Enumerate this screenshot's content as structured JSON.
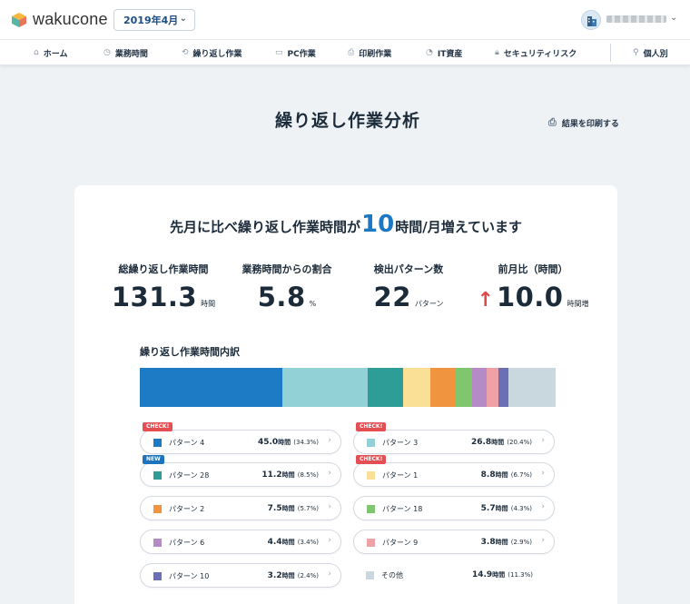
{
  "header": {
    "logo_text": "wakucone",
    "month": "2019年4月",
    "user_name_redacted": ""
  },
  "nav": {
    "items": [
      {
        "label": "ホーム",
        "icon": "home-icon"
      },
      {
        "label": "業務時間",
        "icon": "clock-icon"
      },
      {
        "label": "繰り返し作業",
        "icon": "repeat-icon"
      },
      {
        "label": "PC作業",
        "icon": "monitor-icon"
      },
      {
        "label": "印刷作業",
        "icon": "printer-icon"
      },
      {
        "label": "IT資産",
        "icon": "asset-icon"
      },
      {
        "label": "セキュリティリスク",
        "icon": "lock-icon"
      },
      {
        "label": "個人別",
        "icon": "person-icon"
      }
    ]
  },
  "page": {
    "title": "繰り返し作業分析",
    "print_label": "結果を印刷する"
  },
  "summary": {
    "headline_prefix": "先月に比べ繰り返し作業時間が",
    "headline_value": "10",
    "headline_suffix": "時間/月増えています",
    "stats": [
      {
        "label": "総繰り返し作業時間",
        "value": "131.3",
        "unit": "時間"
      },
      {
        "label": "業務時間からの割合",
        "value": "5.8",
        "unit": "%"
      },
      {
        "label": "検出パターン数",
        "value": "22",
        "unit": "パターン"
      },
      {
        "label": "前月比（時間）",
        "value": "10.0",
        "unit": "時間増"
      }
    ]
  },
  "breakdown": {
    "title": "繰り返し作業時間内訳",
    "patterns": [
      {
        "name": "パターン 4",
        "hours": "45.0",
        "unit": "時間",
        "pct": "(34.3%)",
        "share": 34.3,
        "color": "#1c7bc4",
        "badge": "CHECK!"
      },
      {
        "name": "パターン 3",
        "hours": "26.8",
        "unit": "時間",
        "pct": "(20.4%)",
        "share": 20.4,
        "color": "#92d2d6",
        "badge": "CHECK!"
      },
      {
        "name": "パターン 28",
        "hours": "11.2",
        "unit": "時間",
        "pct": "(8.5%)",
        "share": 8.5,
        "color": "#2e9c97",
        "badge": "NEW"
      },
      {
        "name": "パターン 1",
        "hours": "8.8",
        "unit": "時間",
        "pct": "(6.7%)",
        "share": 6.7,
        "color": "#fae097",
        "badge": "CHECK!"
      },
      {
        "name": "パターン 2",
        "hours": "7.5",
        "unit": "時間",
        "pct": "(5.7%)",
        "share": 5.7,
        "color": "#f0943f",
        "badge": ""
      },
      {
        "name": "パターン 18",
        "hours": "5.7",
        "unit": "時間",
        "pct": "(4.3%)",
        "share": 4.3,
        "color": "#7fc66f",
        "badge": ""
      },
      {
        "name": "パターン 6",
        "hours": "4.4",
        "unit": "時間",
        "pct": "(3.4%)",
        "share": 3.4,
        "color": "#b58ac6",
        "badge": ""
      },
      {
        "name": "パターン 9",
        "hours": "3.8",
        "unit": "時間",
        "pct": "(2.9%)",
        "share": 2.9,
        "color": "#eea2a6",
        "badge": ""
      },
      {
        "name": "パターン 10",
        "hours": "3.2",
        "unit": "時間",
        "pct": "(2.4%)",
        "share": 2.4,
        "color": "#6b70b6",
        "badge": ""
      },
      {
        "name": "その他",
        "hours": "14.9",
        "unit": "時間",
        "pct": "(11.3%)",
        "share": 11.3,
        "color": "#c9d7df",
        "badge": ""
      }
    ]
  }
}
